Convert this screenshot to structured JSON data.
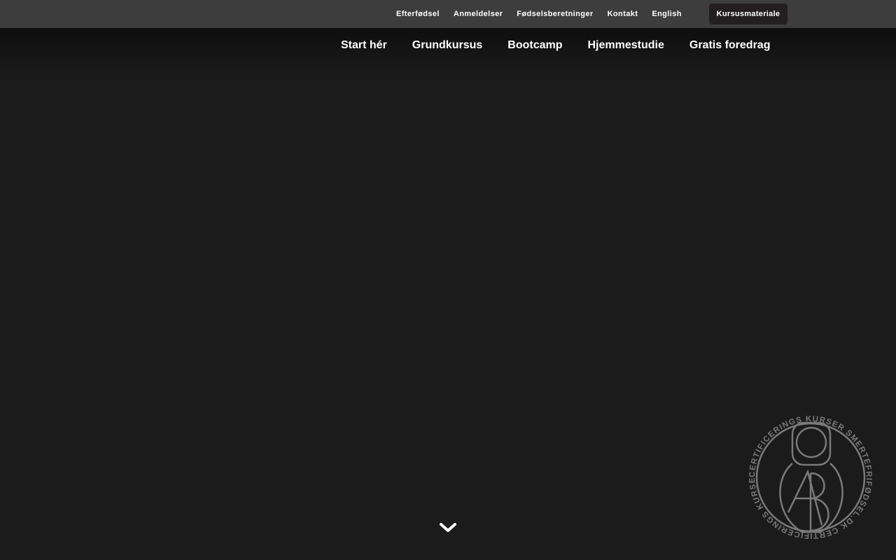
{
  "top_nav": {
    "links": [
      "Efterfødsel",
      "Anmeldelser",
      "Fødselsberetninger",
      "Kontakt",
      "English"
    ],
    "course_button": "Kursusmateriale"
  },
  "main_nav": {
    "links": [
      "Start hér",
      "Grundkursus",
      "Bootcamp",
      "Hjemmestudie",
      "Gratis foredrag"
    ]
  },
  "seal": {
    "text": "CERTIFICERINGS KURSER SMERTEFRIFØDSEL.DK CERTIFICERINGS KURSER SMERTEFRIFØDSEL.DK"
  },
  "colors": {
    "background": "#1b1b1b",
    "top_bar": "#3d3d3d",
    "button": "#231f20",
    "seal": "#7a7a7a"
  },
  "icons": {
    "scroll": "chevron-down-icon",
    "logo": "certification-seal-icon"
  }
}
